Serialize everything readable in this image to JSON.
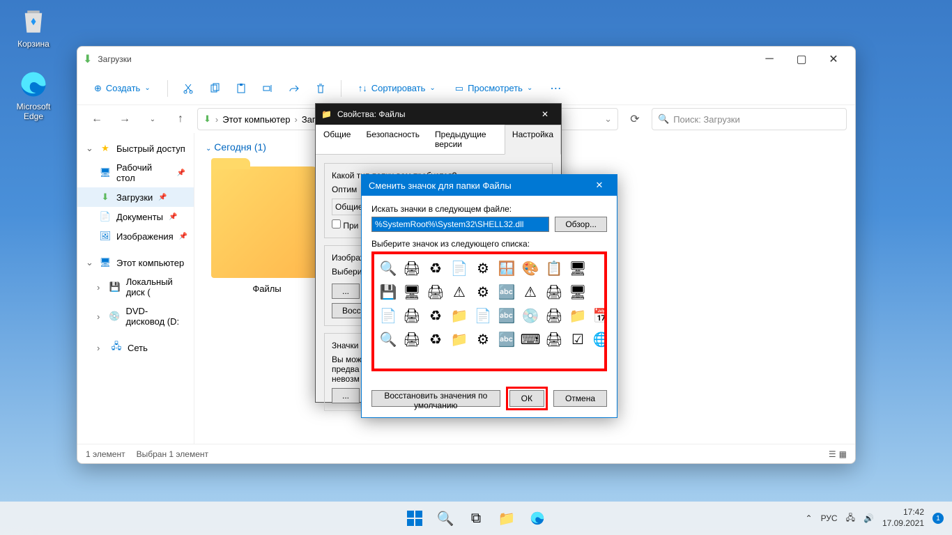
{
  "desktop": {
    "recycle": "Корзина",
    "edge": "Microsoft Edge"
  },
  "explorer": {
    "title": "Загрузки",
    "toolbar": {
      "create": "Создать",
      "sort": "Сортировать",
      "view": "Просмотреть"
    },
    "breadcrumb": {
      "root": "Этот компьютер",
      "current": "Загрузки"
    },
    "search_placeholder": "Поиск: Загрузки",
    "sidebar": {
      "quick_access": "Быстрый доступ",
      "desktop": "Рабочий стол",
      "downloads": "Загрузки",
      "documents": "Документы",
      "pictures": "Изображения",
      "this_pc": "Этот компьютер",
      "local_disk": "Локальный диск (",
      "dvd": "DVD-дисковод (D:",
      "network": "Сеть"
    },
    "group_today": "Сегодня (1)",
    "folder_name": "Файлы",
    "status_count": "1 элемент",
    "status_selected": "Выбран 1 элемент"
  },
  "props": {
    "title": "Свойства: Файлы",
    "tabs": {
      "general": "Общие",
      "security": "Безопасность",
      "previous": "Предыдущие версии",
      "settings": "Настройка"
    },
    "type_label": "Какой тип папки вам требуется?",
    "optimize": "Оптим",
    "general_items": "Общие",
    "apply_checkbox": "При",
    "images_label": "Изображ",
    "select_label": "Выбери",
    "restore_btn": "Восс",
    "icons_label": "Значки",
    "you_can": "Вы мож",
    "preview": "предва",
    "revert": "невозм"
  },
  "change_icon": {
    "title": "Сменить значок для папки Файлы",
    "search_label": "Искать значки в следующем файле:",
    "path": "%SystemRoot%\\System32\\SHELL32.dll",
    "browse": "Обзор...",
    "select_label": "Выберите значок из следующего списка:",
    "restore_defaults": "Восстановить значения по умолчанию",
    "ok": "ОК",
    "cancel": "Отмена"
  },
  "taskbar": {
    "lang": "РУС",
    "time": "17:42",
    "date": "17.09.2021",
    "notif_count": "1"
  }
}
